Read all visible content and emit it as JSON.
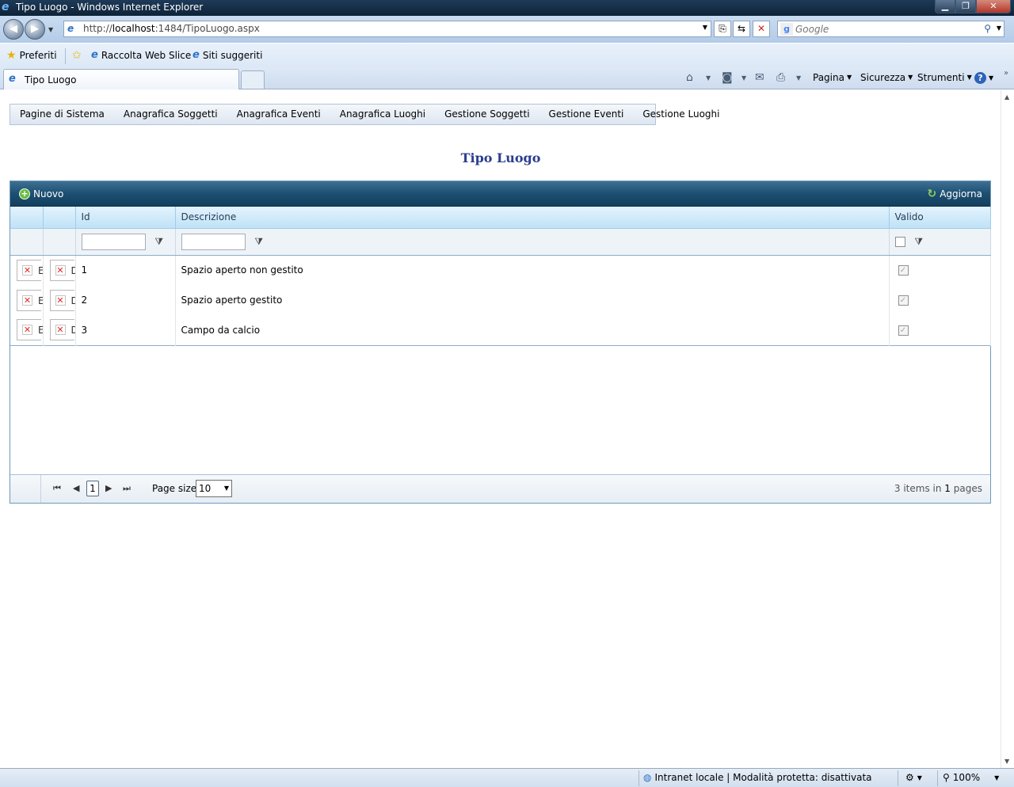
{
  "window": {
    "title": "Tipo Luogo - Windows Internet Explorer",
    "min": "▁",
    "max": "❐",
    "close": "✕"
  },
  "address": {
    "url_prefix": "http://",
    "url_host": "localhost",
    "url_rest": ":1484/TipoLuogo.aspx",
    "search_placeholder": "Google"
  },
  "favorites": {
    "preferiti": "Preferiti",
    "web_slice": "Raccolta Web Slice",
    "siti": "Siti suggeriti"
  },
  "tab": {
    "label": "Tipo Luogo"
  },
  "commands": {
    "pagina": "Pagina",
    "sicurezza": "Sicurezza",
    "strumenti": "Strumenti"
  },
  "menu": [
    "Pagine di Sistema",
    "Anagrafica Soggetti",
    "Anagrafica Eventi",
    "Anagrafica Luoghi",
    "Gestione Soggetti",
    "Gestione Eventi",
    "Gestione Luoghi"
  ],
  "page_title": "Tipo Luogo",
  "grid": {
    "new_label": "Nuovo",
    "refresh_label": "Aggiorna",
    "columns": {
      "id": "Id",
      "descrizione": "Descrizione",
      "valido": "Valido"
    },
    "rows": [
      {
        "edit": "E",
        "delete": "D",
        "id": "1",
        "descrizione": "Spazio aperto non gestito",
        "valido": true
      },
      {
        "edit": "E",
        "delete": "D",
        "id": "2",
        "descrizione": "Spazio aperto gestito",
        "valido": true
      },
      {
        "edit": "E",
        "delete": "D",
        "id": "3",
        "descrizione": "Campo da calcio",
        "valido": true
      }
    ],
    "pager": {
      "current_page": "1",
      "page_size_label": "Page size:",
      "page_size": "10",
      "items_count": "3",
      "items_text": "items in",
      "pages_count": "1",
      "pages_text": "pages"
    }
  },
  "status": {
    "zone": "Intranet locale | Modalità protetta: disattivata",
    "zoom": "100%"
  }
}
